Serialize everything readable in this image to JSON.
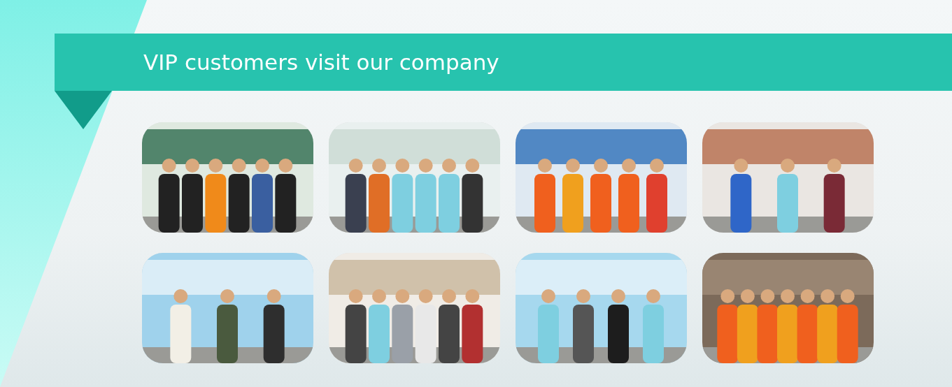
{
  "banner": {
    "title": "VIP customers visit our company"
  }
}
